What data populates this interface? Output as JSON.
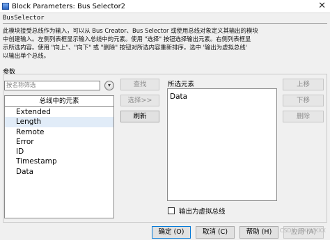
{
  "window": {
    "title": "Block Parameters: Bus Selector2",
    "close_glyph": "✕"
  },
  "block": {
    "type": "BusSelector",
    "description_lines": [
      "此模块接受总线作为输入，可以从 Bus Creator、Bus Selector 或使用总线对象定义其输出的模块",
      "中创建输入。左侧列表框显示输入总线中的元素。使用 \"选择\" 按钮选择输出元素。右侧列表框显",
      "示所选内容。使用 \"向上\"、\"向下\" 或 \"删除\" 按钮对所选内容重新排序。选中 '输出为虚拟总线'",
      "以输出单个总线。"
    ]
  },
  "params": {
    "label": "参数",
    "search_placeholder": "按名称筛选",
    "filter_icon": "filter-options-icon",
    "left_list": {
      "header": "总线中的元素",
      "items": [
        "Extended",
        "Length",
        "Remote",
        "Error",
        "ID",
        "Timestamp",
        "Data"
      ],
      "selected_index": 1
    },
    "middle_buttons": {
      "find": "查找",
      "select": "选择>>",
      "refresh": "刷新"
    },
    "right_list": {
      "label": "所选元素",
      "items": [
        "Data"
      ]
    },
    "right_buttons": {
      "up": "上移",
      "down": "下移",
      "remove": "删除"
    },
    "virtual_bus": {
      "label": "输出为虚拟总线",
      "checked": false
    }
  },
  "footer": {
    "ok": "确定 (O)",
    "cancel": "取消 (C)",
    "help": "帮助 (H)",
    "apply": "应用 (A)"
  },
  "watermark": "CSDN @XXXXXX"
}
